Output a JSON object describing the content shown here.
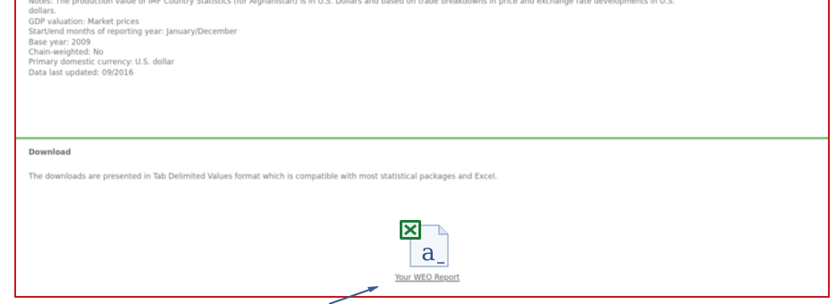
{
  "notes": {
    "lines": [
      "Notes: The production value of IMF Country Statistics (for Afghanistan) is in U.S. Dollars and based on trade breakdowns in price and exchange rate developments in U.S.",
      "dollars.",
      "GDP valuation: Market prices",
      "Start/end months of reporting year: January/December",
      "Base year: 2009",
      "Chain-weighted: No",
      "Primary domestic currency: U.S. dollar",
      "Data last updated: 09/2016"
    ]
  },
  "download": {
    "title": "Download",
    "description": "The downloads are presented in Tab Delimited Values format which is compatible with most statistical packages and Excel.",
    "file_icon": "excel-text-file-icon",
    "link_label": "Your WEO Report"
  },
  "colors": {
    "frame_border": "#c8171e",
    "divider": "#8fc98f",
    "arrow": "#3b5a8c",
    "excel_green": "#1f7a3a"
  }
}
